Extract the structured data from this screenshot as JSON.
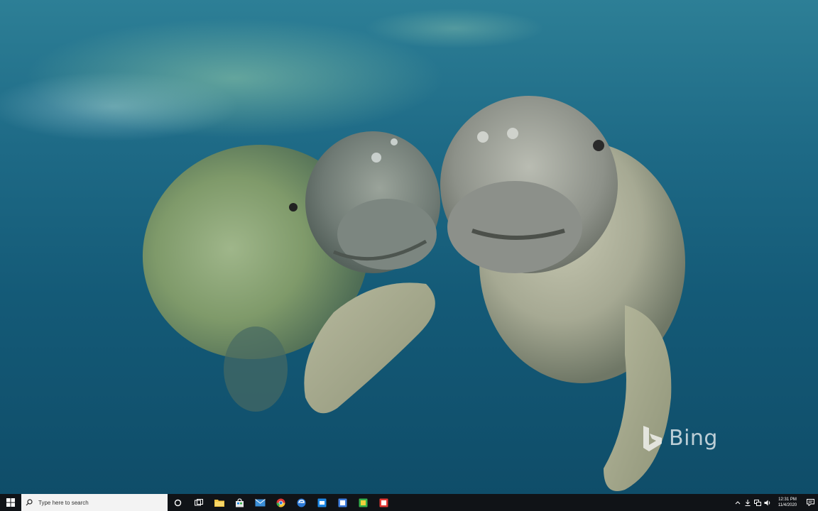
{
  "desktop": {
    "wallpaper": "Two manatees nuzzling underwater",
    "watermark": "Bing"
  },
  "taskbar": {
    "start_icon": "windows-logo-icon",
    "search": {
      "placeholder": "Type here to search",
      "icon": "search-icon"
    },
    "pinned": [
      {
        "name": "task-view",
        "icon": "task-view-icon"
      },
      {
        "name": "file-explorer",
        "icon": "folder-icon",
        "color": "#f4c542"
      },
      {
        "name": "store",
        "icon": "store-bag-icon",
        "color": "#e8e8e8"
      },
      {
        "name": "mail",
        "icon": "mail-icon",
        "color": "#3b8fd8"
      },
      {
        "name": "chrome",
        "icon": "chrome-icon",
        "color": "#f2a33a"
      },
      {
        "name": "edge",
        "icon": "edge-icon",
        "color": "#2d7ad6"
      },
      {
        "name": "app-blue-1",
        "icon": "app-icon",
        "color": "#1e88e5"
      },
      {
        "name": "app-blue-2",
        "icon": "app-icon",
        "color": "#3f7fe0"
      },
      {
        "name": "app-green",
        "icon": "app-icon",
        "color": "#36b14a"
      },
      {
        "name": "app-red",
        "icon": "app-icon",
        "color": "#e53935"
      }
    ],
    "tray": {
      "clock_time": "12:31 PM",
      "clock_date": "11/4/2020"
    }
  }
}
